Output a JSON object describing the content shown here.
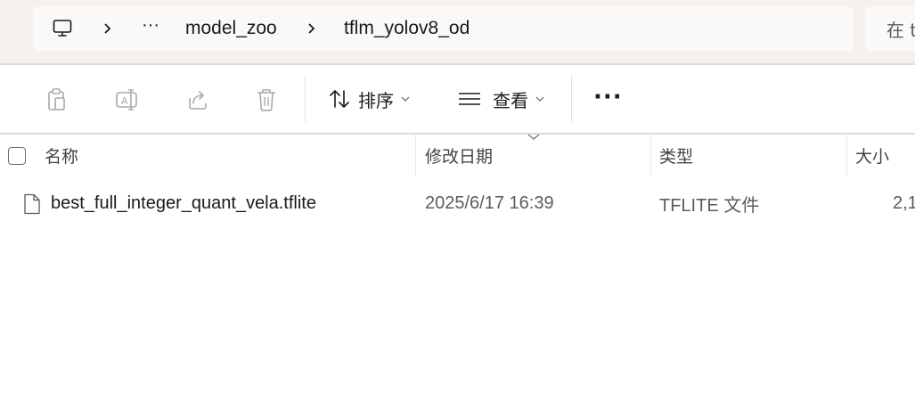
{
  "address": {
    "ellipsis": "···",
    "crumbs": [
      "model_zoo",
      "tflm_yolov8_od"
    ],
    "search_text": "在 t"
  },
  "toolbar": {
    "sort_label": "排序",
    "view_label": "查看",
    "more_label": "···"
  },
  "columns": {
    "name": "名称",
    "date": "修改日期",
    "type": "类型",
    "size": "大小"
  },
  "files": [
    {
      "name": "best_full_integer_quant_vela.tflite",
      "date": "2025/6/17 16:39",
      "type": "TFLITE 文件",
      "size": "2,1"
    }
  ]
}
